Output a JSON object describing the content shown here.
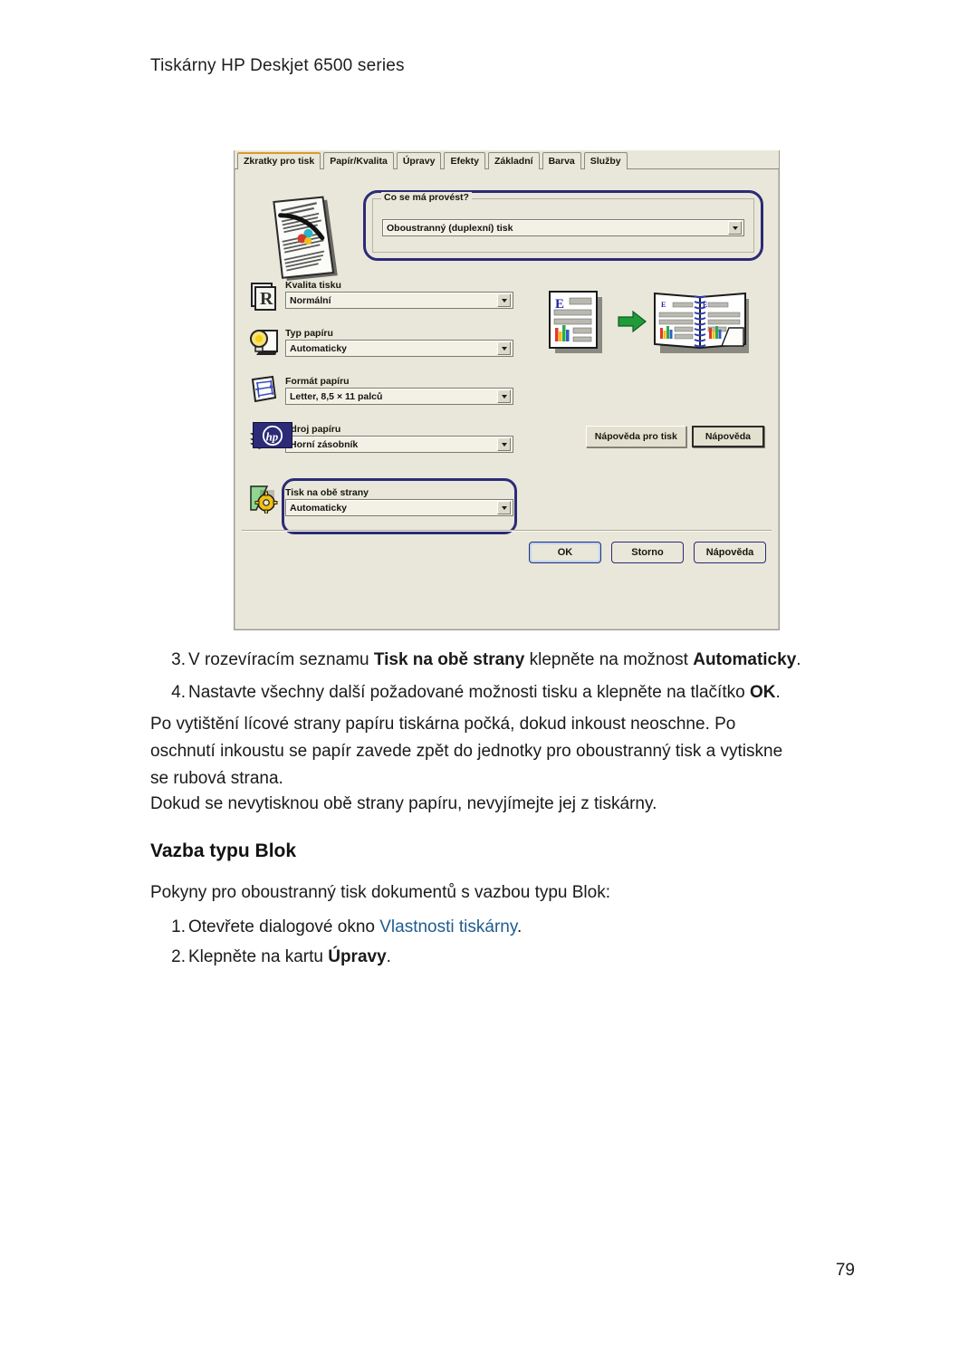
{
  "page": {
    "header": "Tiskárny HP Deskjet 6500 series",
    "number": "79"
  },
  "dialog": {
    "tabs": [
      {
        "label": "Zkratky pro tisk",
        "active": true
      },
      {
        "label": "Papír/Kvalita",
        "active": false
      },
      {
        "label": "Úpravy",
        "active": false
      },
      {
        "label": "Efekty",
        "active": false
      },
      {
        "label": "Základní",
        "active": false
      },
      {
        "label": "Barva",
        "active": false
      },
      {
        "label": "Služby",
        "active": false
      }
    ],
    "group": {
      "title": "Co se má provést?",
      "value": "Oboustranný (duplexní) tisk"
    },
    "settings": [
      {
        "label": "Kvalita tisku",
        "value": "Normální",
        "icon": "print-quality-icon"
      },
      {
        "label": "Typ papíru",
        "value": "Automaticky",
        "icon": "lightbulb-paper-type-icon"
      },
      {
        "label": "Formát papíru",
        "value": "Letter, 8,5 × 11 palců",
        "icon": "paper-size-icon"
      },
      {
        "label": "Zdroj papíru",
        "value": "Horní zásobník",
        "icon": "paper-source-tray-icon"
      },
      {
        "label": "Tisk na obě strany",
        "value": "Automaticky",
        "icon": "duplex-gear-icon"
      }
    ],
    "panel_buttons": [
      {
        "label": "Nápověda pro tisk"
      },
      {
        "label": "Nápověda"
      }
    ],
    "dialog_buttons": [
      {
        "label": "OK",
        "focused": true
      },
      {
        "label": "Storno",
        "focused": false
      },
      {
        "label": "Nápověda",
        "focused": false
      }
    ],
    "preview": {
      "source_letter": "E",
      "arrow": "green-right-arrow"
    },
    "highlight_color": "#2b2b77",
    "active_tab_accent": "#d99b2b",
    "background_color": "#e9e7d9"
  },
  "content": {
    "steps_top": [
      {
        "num": "3.",
        "parts": [
          {
            "t": "V rozevíracím seznamu ",
            "b": false
          },
          {
            "t": "Tisk na obě strany",
            "b": true
          },
          {
            "t": " klepněte na možnost ",
            "b": false
          },
          {
            "t": "Automaticky",
            "b": true
          },
          {
            "t": ".",
            "b": false
          }
        ]
      },
      {
        "num": "4.",
        "parts": [
          {
            "t": "Nastavte všechny další požadované možnosti tisku a klepněte na tlačítko ",
            "b": false
          },
          {
            "t": "OK",
            "b": true
          },
          {
            "t": ".",
            "b": false
          }
        ]
      }
    ],
    "paragraph1_line1": "Po vytištění lícové strany papíru tiskárna počká, dokud inkoust neoschne. Po",
    "paragraph1_line2": "oschnutí inkoustu se papír zavede zpět do jednotky pro oboustranný tisk a vytiskne",
    "paragraph1_line3": "se rubová strana.",
    "paragraph2": "Dokud se nevytisknou obě strany papíru, nevyjímejte jej z tiskárny.",
    "heading": "Vazba typu Blok",
    "intro": "Pokyny pro oboustranný tisk dokumentů s vazbou typu Blok:",
    "steps_bottom": [
      {
        "num": "1.",
        "parts": [
          {
            "t": "Otevřete dialogové okno ",
            "b": false,
            "link": false
          },
          {
            "t": "Vlastnosti tiskárny",
            "b": false,
            "link": true
          },
          {
            "t": ".",
            "b": false,
            "link": false
          }
        ]
      },
      {
        "num": "2.",
        "parts": [
          {
            "t": "Klepněte na kartu ",
            "b": false,
            "link": false
          },
          {
            "t": "Úpravy",
            "b": true,
            "link": false
          },
          {
            "t": ".",
            "b": false,
            "link": false
          }
        ]
      }
    ]
  }
}
